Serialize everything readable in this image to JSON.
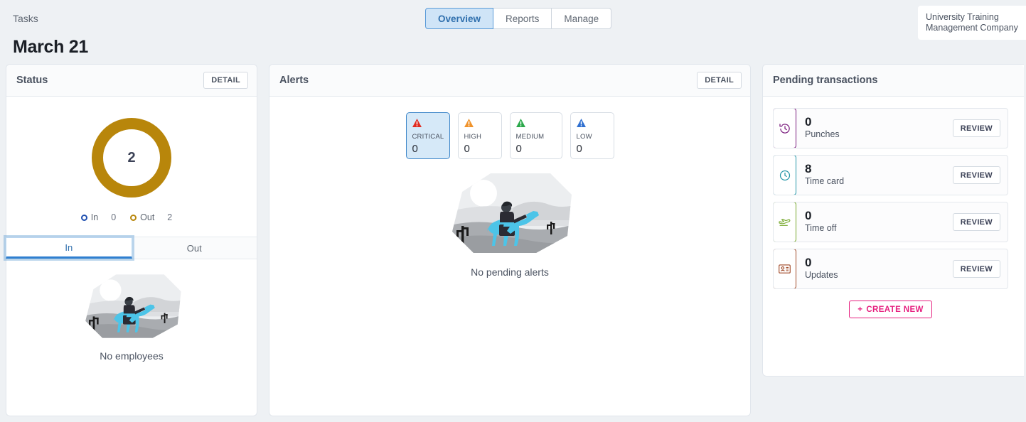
{
  "header": {
    "breadcrumb": "Tasks",
    "page_title": "March 21",
    "company": "University Training Management Company",
    "tabs": [
      {
        "label": "Overview",
        "active": true
      },
      {
        "label": "Reports",
        "active": false
      },
      {
        "label": "Manage",
        "active": false
      }
    ]
  },
  "status_card": {
    "title": "Status",
    "detail_label": "DETAIL",
    "donut_center": "2",
    "legend": [
      {
        "label": "In",
        "value": "0",
        "color": "#1f4fb0"
      },
      {
        "label": "Out",
        "value": "2",
        "color": "#b8860b"
      }
    ],
    "switch": [
      {
        "label": "In",
        "active": true
      },
      {
        "label": "Out",
        "active": false
      }
    ],
    "empty_label": "No employees"
  },
  "alerts_card": {
    "title": "Alerts",
    "detail_label": "DETAIL",
    "severities": [
      {
        "label": "CRITICAL",
        "count": "0",
        "color": "#e02b20",
        "selected": true
      },
      {
        "label": "HIGH",
        "count": "0",
        "color": "#f0932b",
        "selected": false
      },
      {
        "label": "MEDIUM",
        "count": "0",
        "color": "#2aa84a",
        "selected": false
      },
      {
        "label": "LOW",
        "count": "0",
        "color": "#2f6fd0",
        "selected": false
      }
    ],
    "empty_label": "No pending alerts"
  },
  "pending_card": {
    "title": "Pending transactions",
    "rows": [
      {
        "count": "0",
        "name": "Punches",
        "review_label": "REVIEW",
        "color": "#7b1d7e",
        "icon": "history-icon"
      },
      {
        "count": "8",
        "name": "Time card",
        "review_label": "REVIEW",
        "color": "#2596a8",
        "icon": "clock-icon"
      },
      {
        "count": "0",
        "name": "Time off",
        "review_label": "REVIEW",
        "color": "#76a82b",
        "icon": "airplane-icon"
      },
      {
        "count": "0",
        "name": "Updates",
        "review_label": "REVIEW",
        "color": "#a04a28",
        "icon": "id-card-icon"
      }
    ],
    "create_label": "CREATE NEW",
    "create_plus": "+"
  },
  "chart_data": {
    "type": "pie",
    "title": "Status",
    "categories": [
      "In",
      "Out"
    ],
    "values": [
      0,
      2
    ],
    "total": 2,
    "colors": [
      "#1f4fb0",
      "#b8860b"
    ],
    "legend_position": "bottom"
  }
}
